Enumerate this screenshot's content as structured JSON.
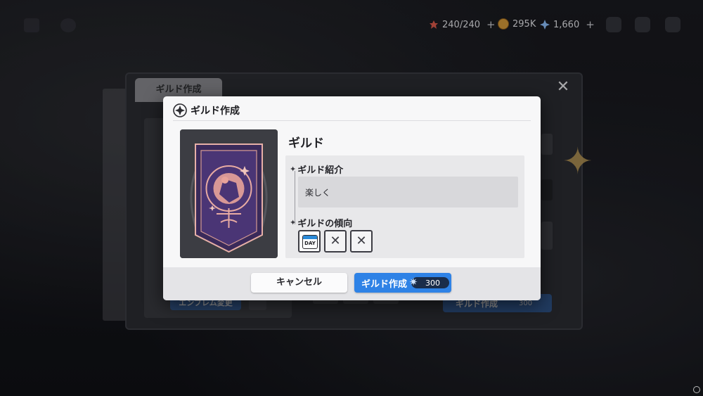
{
  "topbar": {
    "resources": [
      {
        "icon": "stamina-icon",
        "value": "240/240",
        "has_plus": true
      },
      {
        "icon": "gold-coin-icon",
        "value": "295K",
        "has_plus": false
      },
      {
        "icon": "crystal-icon",
        "value": "1,660",
        "has_plus": true
      }
    ],
    "plus": "+"
  },
  "background": {
    "tab_label": "ギルド作成",
    "close_glyph": "✕",
    "emblem_change_label": "エンブレム変更",
    "create_label": "ギルド作成",
    "create_cost": "300"
  },
  "dialog": {
    "title": "ギルド作成",
    "guild_name": "ギルド",
    "intro_label": "ギルド紹介",
    "intro_text": "楽しく",
    "tendency_label": "ギルドの傾向",
    "tendencies": [
      {
        "icon": "calendar-day-icon",
        "label": "DAY"
      },
      {
        "icon": "empty-slot-icon",
        "label": "✕"
      },
      {
        "icon": "empty-slot-icon",
        "label": "✕"
      }
    ],
    "cancel_label": "キャンセル",
    "create_label": "ギルド作成",
    "create_cost": "300",
    "accent_color": "#2e82e6"
  }
}
